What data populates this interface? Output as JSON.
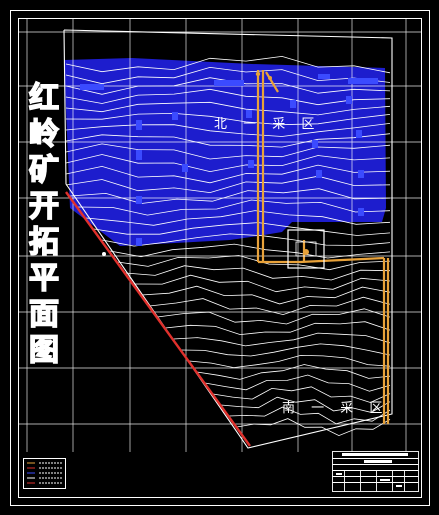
{
  "drawing": {
    "title_vertical": [
      "红",
      "岭",
      "矿",
      "开",
      "拓",
      "平",
      "面",
      "图"
    ],
    "zones": {
      "north": "北 一 采 区",
      "south": "南 一 采 区"
    }
  },
  "colors": {
    "background": "#000000",
    "contour": "#ffffff",
    "ore_body": "#1f1fd8",
    "ore_block": "#2a35ff",
    "fault_line": "#e0302c",
    "shaft": "#e8a23a",
    "grid": "#ffffff",
    "frame": "#ffffff"
  }
}
